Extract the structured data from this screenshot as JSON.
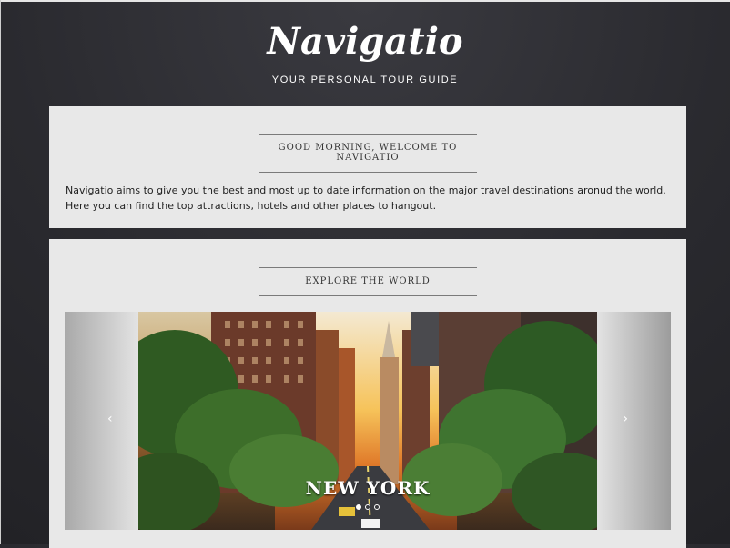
{
  "header": {
    "logo": "Navigatio",
    "tagline": "YOUR PERSONAL TOUR GUIDE"
  },
  "welcome": {
    "title": "GOOD MORNING, WELCOME TO NAVIGATIO",
    "text": "Navigatio aims to give you the best and most up to date information on the major travel destinations aronud the world. Here you can find the top attractions, hotels and other places to hangout."
  },
  "explore": {
    "title": "EXPLORE THE WORLD",
    "carousel": {
      "prev_icon": "‹",
      "next_icon": "›",
      "slide_caption": "NEW YORK",
      "active_index": 0,
      "slide_count": 3
    }
  }
}
